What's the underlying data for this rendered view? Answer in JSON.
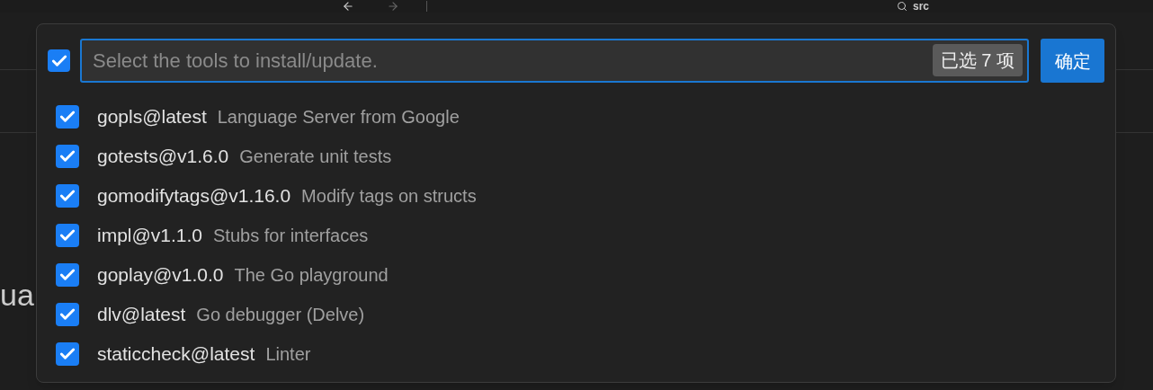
{
  "title_bar": {
    "search": "src"
  },
  "editor": {
    "heading_fragment": "ua"
  },
  "quick_pick": {
    "select_all": {
      "checked": true
    },
    "input": {
      "placeholder": "Select the tools to install/update."
    },
    "count_badge": "已选 7 项",
    "ok_button": "确定",
    "items": [
      {
        "name": "gopls@latest",
        "description": "Language Server from Google",
        "checked": true
      },
      {
        "name": "gotests@v1.6.0",
        "description": "Generate unit tests",
        "checked": true
      },
      {
        "name": "gomodifytags@v1.16.0",
        "description": "Modify tags on structs",
        "checked": true
      },
      {
        "name": "impl@v1.1.0",
        "description": "Stubs for interfaces",
        "checked": true
      },
      {
        "name": "goplay@v1.0.0",
        "description": "The Go playground",
        "checked": true
      },
      {
        "name": "dlv@latest",
        "description": "Go debugger (Delve)",
        "checked": true
      },
      {
        "name": "staticcheck@latest",
        "description": "Linter",
        "checked": true
      }
    ]
  }
}
